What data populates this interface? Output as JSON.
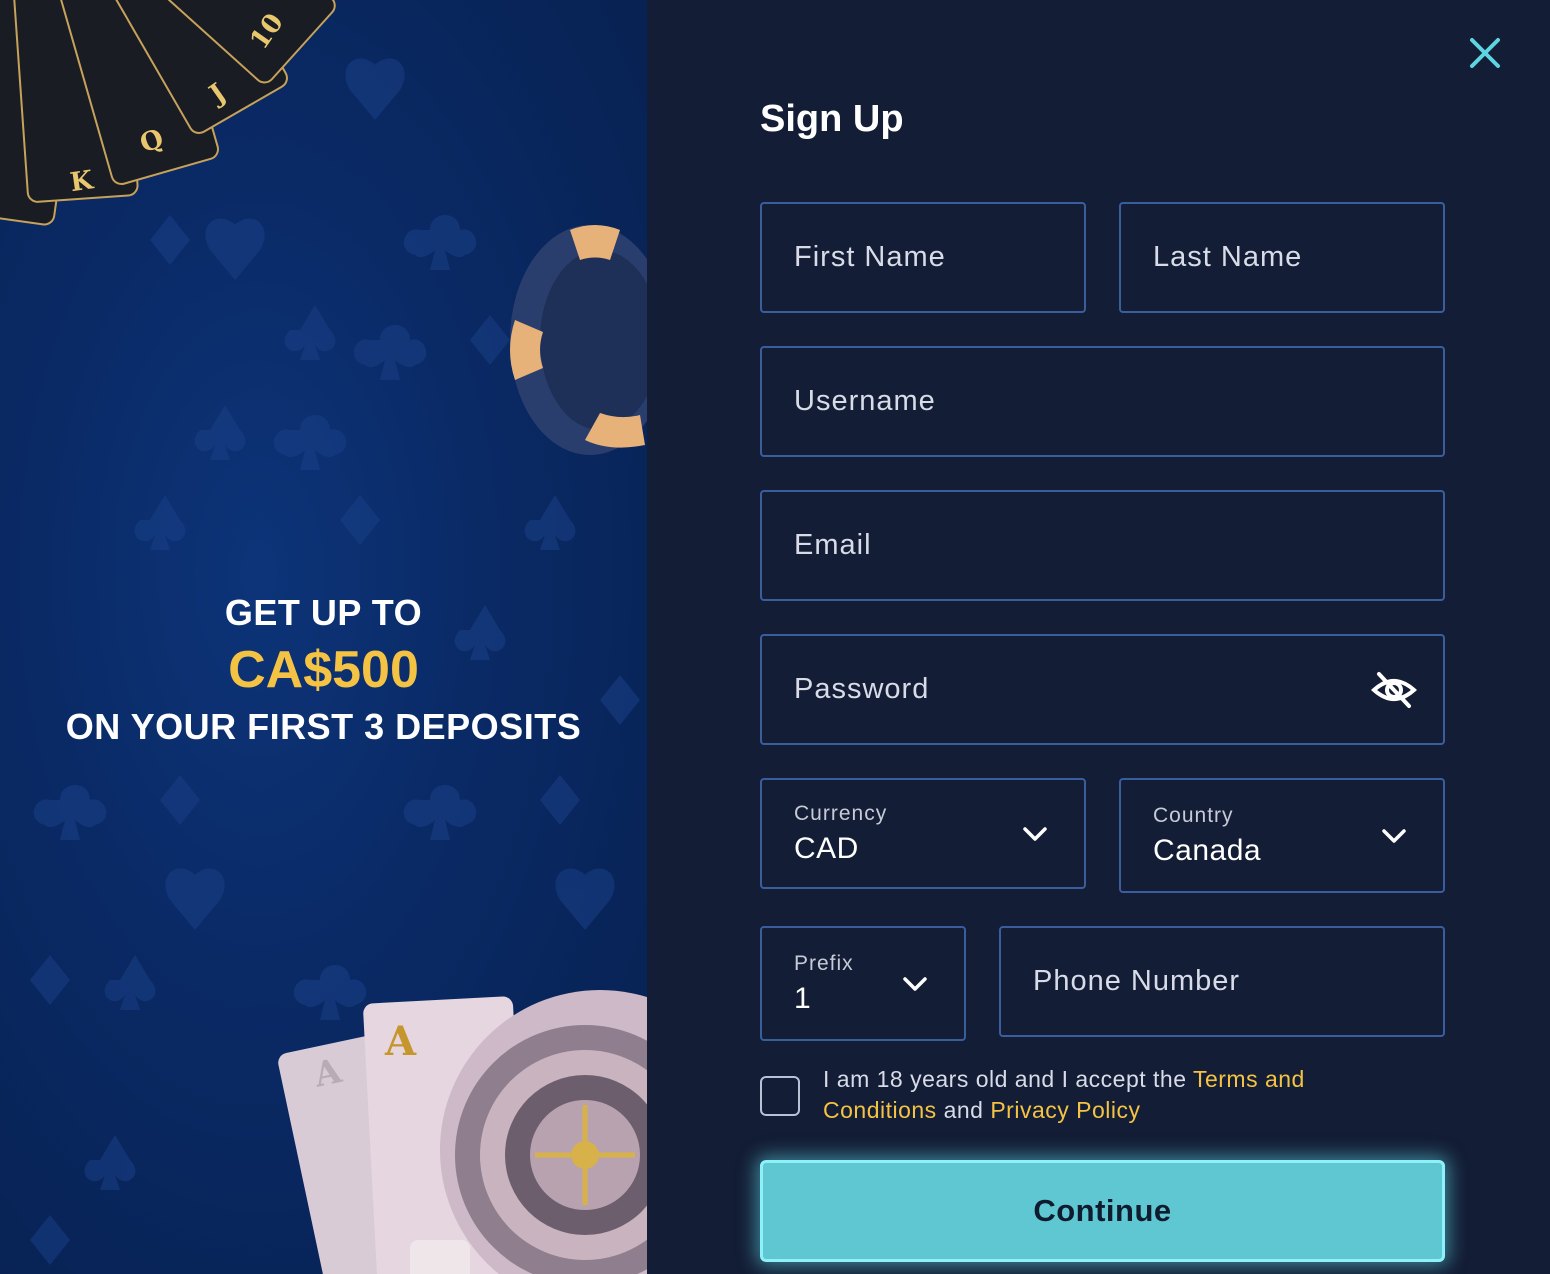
{
  "promo": {
    "line1": "GET UP TO",
    "amount": "CA$500",
    "line3": "ON YOUR FIRST 3 DEPOSITS"
  },
  "form": {
    "title": "Sign Up",
    "close_icon": "close-icon",
    "first_name_placeholder": "First Name",
    "last_name_placeholder": "Last Name",
    "username_placeholder": "Username",
    "email_placeholder": "Email",
    "password_placeholder": "Password",
    "password_toggle_icon": "eye-slash-icon",
    "currency": {
      "label": "Currency",
      "value": "CAD"
    },
    "country": {
      "label": "Country",
      "value": "Canada"
    },
    "prefix": {
      "label": "Prefix",
      "value": "1"
    },
    "phone_placeholder": "Phone Number",
    "terms": {
      "text_before": "I am 18 years old and I accept the ",
      "terms_link": "Terms and Conditions",
      "text_middle": " and ",
      "privacy_link": "Privacy Policy"
    },
    "continue_label": "Continue"
  },
  "colors": {
    "accent_gold": "#f5c344",
    "button_teal": "#5ec7d2",
    "field_border": "#3a5d9e",
    "panel_bg": "#131d35",
    "promo_bg": "#0a2a66"
  }
}
